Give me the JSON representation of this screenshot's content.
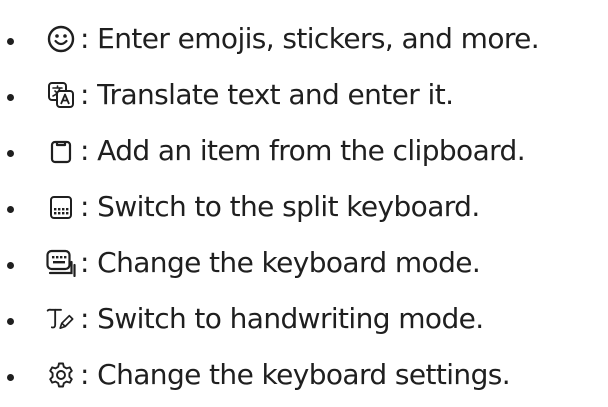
{
  "items": [
    {
      "icon": "emoji-icon",
      "separator": ":",
      "text": "Enter emojis, stickers, and more."
    },
    {
      "icon": "translate-icon",
      "separator": ":",
      "text": "Translate text and enter it."
    },
    {
      "icon": "clipboard-icon",
      "separator": ":",
      "text": "Add an item from the clipboard."
    },
    {
      "icon": "split-keyboard-icon",
      "separator": ":",
      "text": "Switch to the split keyboard."
    },
    {
      "icon": "keyboard-mode-icon",
      "separator": ":",
      "text": "Change the keyboard mode."
    },
    {
      "icon": "handwriting-icon",
      "separator": ":",
      "text": "Switch to handwriting mode."
    },
    {
      "icon": "settings-icon",
      "separator": ":",
      "text": "Change the keyboard settings."
    }
  ]
}
